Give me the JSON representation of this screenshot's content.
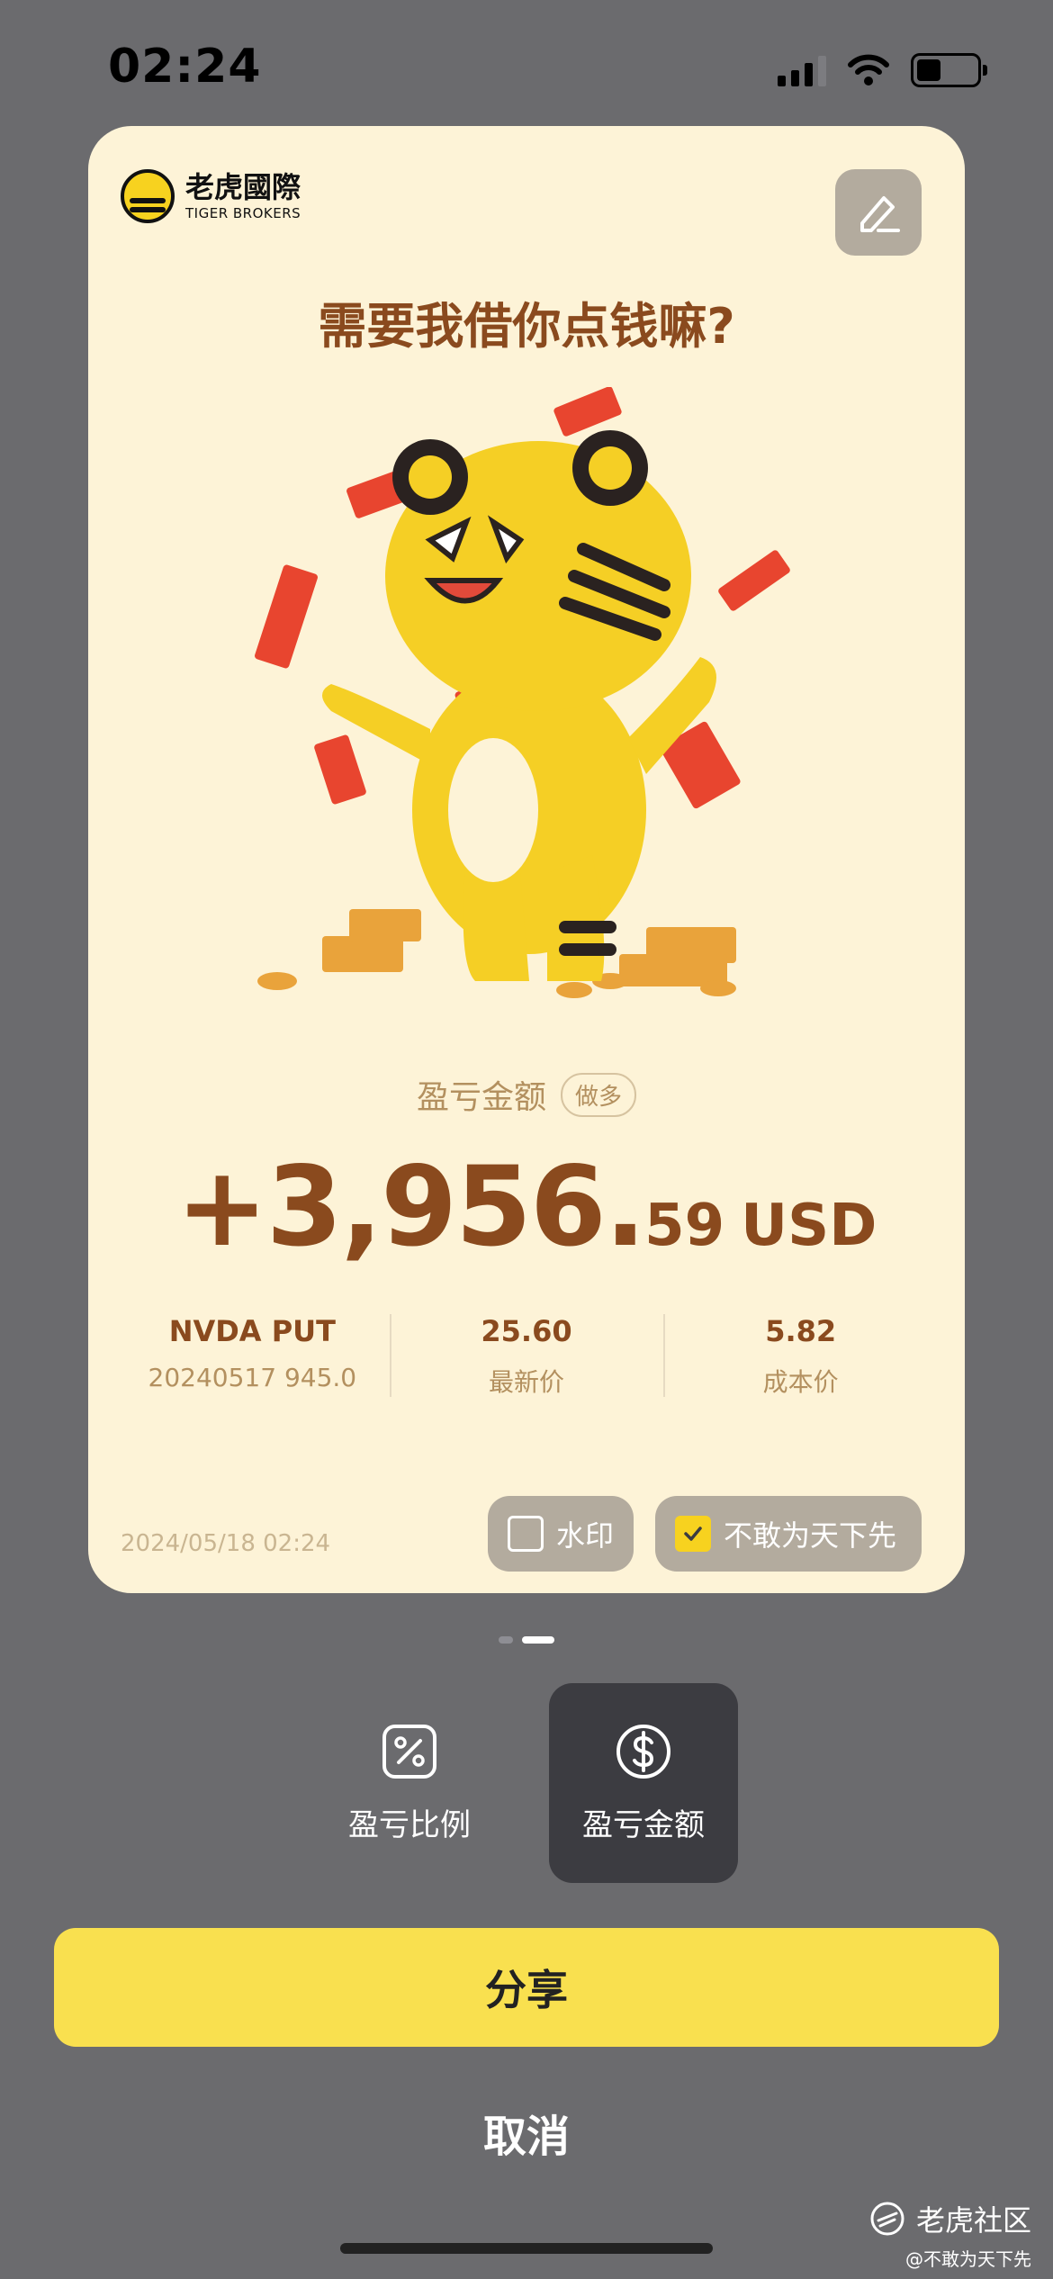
{
  "status_bar": {
    "time": "02:24"
  },
  "card": {
    "brand": {
      "name_cn": "老虎國際",
      "name_en": "TIGER BROKERS"
    },
    "headline": "需要我借你点钱嘛?",
    "pl": {
      "label": "盈亏金额",
      "badge": "做多",
      "amount_main": "+3,956.",
      "amount_decimal": "59",
      "currency": "USD"
    },
    "stats": [
      {
        "top": "NVDA PUT",
        "bottom": "20240517  945.0"
      },
      {
        "top": "25.60",
        "bottom": "最新价"
      },
      {
        "top": "5.82",
        "bottom": "成本价"
      }
    ],
    "date": "2024/05/18 02:24",
    "checkboxes": {
      "watermark": {
        "label": "水印",
        "checked": false
      },
      "slogan": {
        "label": "不敢为天下先",
        "checked": true
      }
    }
  },
  "pager": {
    "count": 2,
    "active": 1
  },
  "mode_tabs": [
    {
      "label": "盈亏比例",
      "icon": "percent-icon",
      "active": false
    },
    {
      "label": "盈亏金额",
      "icon": "dollar-icon",
      "active": true
    }
  ],
  "actions": {
    "share": "分享",
    "cancel": "取消"
  },
  "community_watermark": {
    "name": "老虎社区",
    "user": "@不敢为天下先"
  },
  "colors": {
    "background": "#6b6b6e",
    "card": "#fdf3d7",
    "accent_brown": "#8a4a1e",
    "share_button": "#f9e04f",
    "tiger_yellow": "#f7d21f"
  }
}
